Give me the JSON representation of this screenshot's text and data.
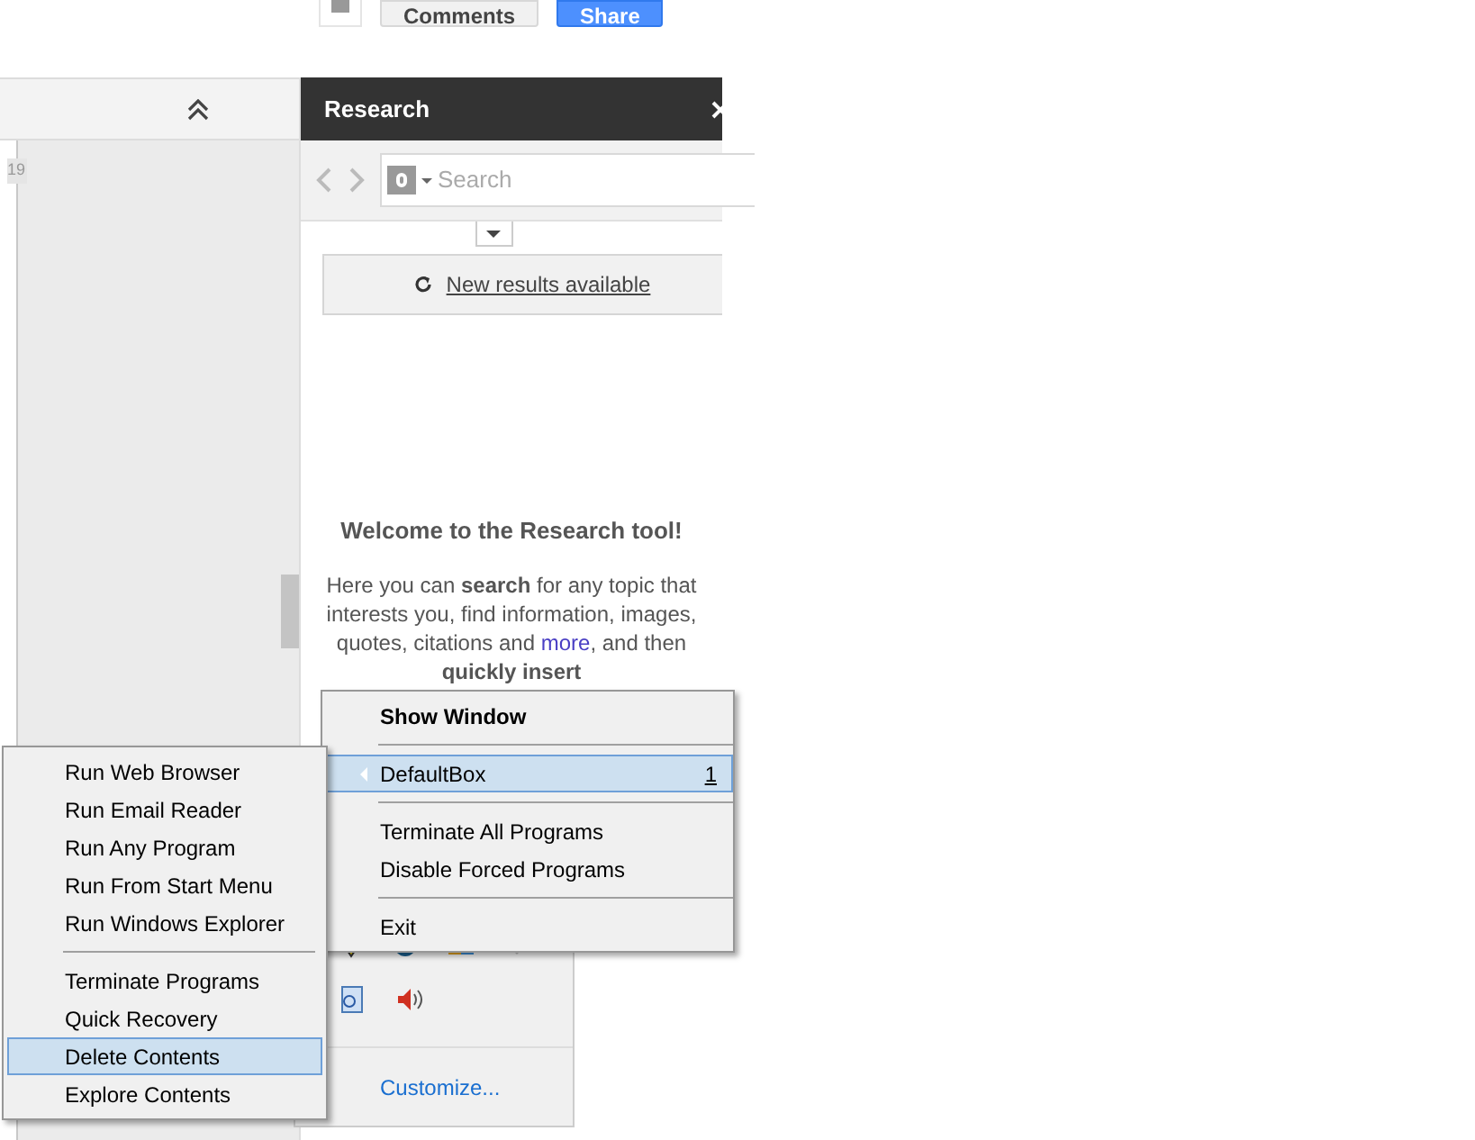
{
  "top_bar": {
    "buttons": [
      {
        "label": "Comments",
        "kind": "default"
      },
      {
        "label": "Share",
        "kind": "primary"
      }
    ]
  },
  "left_panel": {
    "line_number": "19"
  },
  "research": {
    "title": "Research",
    "search": {
      "placeholder": "Search"
    },
    "notice": "New results available",
    "welcome": {
      "heading": "Welcome to the Research tool!",
      "body": [
        {
          "kind": "text",
          "text": "Here you can **search** for any topic that interests you, find information, images, quotes, citations and "
        },
        {
          "kind": "link",
          "text": "more"
        },
        {
          "kind": "text",
          "text": ", and then **quickly insert**"
        }
      ]
    }
  },
  "tray_panel": {
    "customize": "Customize..."
  },
  "tray_menu": {
    "items": [
      {
        "kind": "item",
        "label": "Show Window",
        "bold": true,
        "selected": false
      },
      {
        "kind": "separator"
      },
      {
        "kind": "submenu",
        "label": "DefaultBox",
        "shortcut": "1",
        "bold": false,
        "selected": true
      },
      {
        "kind": "separator"
      },
      {
        "kind": "item",
        "label": "Terminate All Programs",
        "bold": false,
        "selected": false
      },
      {
        "kind": "item",
        "label": "Disable Forced Programs",
        "bold": false,
        "selected": false
      },
      {
        "kind": "separator"
      },
      {
        "kind": "item",
        "label": "Exit",
        "bold": false,
        "selected": false
      }
    ]
  },
  "sandbox_menu": {
    "items": [
      {
        "kind": "item",
        "label": "Run Web Browser",
        "selected": false
      },
      {
        "kind": "item",
        "label": "Run Email Reader",
        "selected": false
      },
      {
        "kind": "item",
        "label": "Run Any Program",
        "selected": false
      },
      {
        "kind": "item",
        "label": "Run From Start Menu",
        "selected": false
      },
      {
        "kind": "item",
        "label": "Run Windows Explorer",
        "selected": false
      },
      {
        "kind": "separator"
      },
      {
        "kind": "item",
        "label": "Terminate Programs",
        "selected": false
      },
      {
        "kind": "item",
        "label": "Quick Recovery",
        "selected": false
      },
      {
        "kind": "item",
        "label": "Delete Contents",
        "selected": true
      },
      {
        "kind": "item",
        "label": "Explore Contents",
        "selected": false
      }
    ]
  }
}
